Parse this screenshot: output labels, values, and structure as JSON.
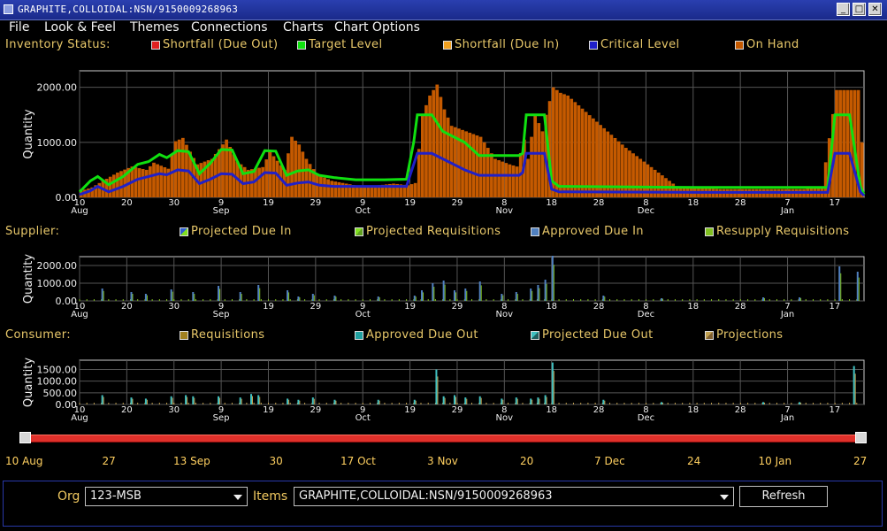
{
  "window": {
    "title": "GRAPHITE,COLLOIDAL:NSN/9150009268963"
  },
  "menu": [
    {
      "label": "File"
    },
    {
      "label": "Look & Feel"
    },
    {
      "label": "Themes"
    },
    {
      "label": "Connections"
    },
    {
      "label": "Charts"
    },
    {
      "label": "Chart Options"
    }
  ],
  "colors": {
    "on_hand": "#c55a00",
    "target": "#10e010",
    "critical": "#2020c8",
    "shortfall_out": "#e02020",
    "shortfall_in": "#f0a020",
    "slider": "#e0302a"
  },
  "inventory": {
    "title": "Inventory Status:",
    "legend": [
      {
        "label": "Shortfall (Due Out)",
        "color": "#e02020"
      },
      {
        "label": "Target Level",
        "color": "#10e010"
      },
      {
        "label": "Shortfall (Due In)",
        "color": "#f0a020"
      },
      {
        "label": "Critical Level",
        "color": "#2020c8"
      },
      {
        "label": "On Hand",
        "color": "#c55a00"
      }
    ]
  },
  "supplier": {
    "title": "Supplier:",
    "legend": [
      {
        "label": "Projected Due In",
        "color": "#3060d0"
      },
      {
        "label": "Projected Requisitions",
        "color": "#80e020"
      },
      {
        "label": "Approved Due In",
        "color": "#5080c0"
      },
      {
        "label": "Resupply Requisitions",
        "color": "#80c020"
      }
    ]
  },
  "consumer": {
    "title": "Consumer:",
    "legend": [
      {
        "label": "Requisitions",
        "color": "#a08020"
      },
      {
        "label": "Approved Due Out",
        "color": "#20a0a0"
      },
      {
        "label": "Projected Due Out",
        "color": "#40c0c0"
      },
      {
        "label": "Projections",
        "color": "#c0a050"
      }
    ]
  },
  "chart_data": [
    {
      "type": "area",
      "ylabel": "Quantity",
      "ylim": [
        0,
        2300
      ],
      "y_ticks": [
        "2000.00",
        "1000.00",
        "0.00"
      ],
      "x_ticks": [
        "10\nAug",
        "20",
        "30",
        "9\nSep",
        "19",
        "29",
        "9\nOct",
        "19",
        "29",
        "8\nNov",
        "18",
        "28",
        "8\nDec",
        "18",
        "28",
        "7\nJan",
        "17"
      ],
      "x_day_range": [
        0,
        170
      ],
      "on_hand": [
        [
          0,
          120
        ],
        [
          3,
          180
        ],
        [
          6,
          300
        ],
        [
          10,
          450
        ],
        [
          14,
          560
        ],
        [
          18,
          500
        ],
        [
          20,
          630
        ],
        [
          24,
          520
        ],
        [
          26,
          1020
        ],
        [
          28,
          1080
        ],
        [
          30,
          830
        ],
        [
          32,
          600
        ],
        [
          36,
          700
        ],
        [
          40,
          1050
        ],
        [
          43,
          650
        ],
        [
          46,
          500
        ],
        [
          50,
          550
        ],
        [
          52,
          830
        ],
        [
          56,
          500
        ],
        [
          58,
          1100
        ],
        [
          60,
          960
        ],
        [
          62,
          700
        ],
        [
          65,
          420
        ],
        [
          69,
          300
        ],
        [
          73,
          250
        ],
        [
          77,
          200
        ],
        [
          82,
          220
        ],
        [
          86,
          250
        ],
        [
          90,
          220
        ],
        [
          92,
          260
        ],
        [
          94,
          1500
        ],
        [
          96,
          1850
        ],
        [
          98,
          2050
        ],
        [
          100,
          1600
        ],
        [
          102,
          1300
        ],
        [
          104,
          1250
        ],
        [
          106,
          1200
        ],
        [
          110,
          1100
        ],
        [
          114,
          700
        ],
        [
          118,
          600
        ],
        [
          120,
          560
        ],
        [
          122,
          1050
        ],
        [
          123,
          700
        ],
        [
          125,
          1500
        ],
        [
          127,
          1200
        ],
        [
          128,
          1500
        ],
        [
          130,
          2000
        ],
        [
          132,
          1900
        ],
        [
          134,
          1850
        ],
        [
          150,
          900
        ],
        [
          164,
          200
        ],
        [
          176,
          150
        ],
        [
          188,
          150
        ],
        [
          199,
          150
        ],
        [
          204,
          200
        ],
        [
          208,
          1950
        ],
        [
          210,
          1950
        ],
        [
          214,
          1950
        ],
        [
          216,
          50
        ]
      ],
      "series": [
        {
          "name": "Target Level",
          "points": [
            [
              0,
              100
            ],
            [
              3,
              300
            ],
            [
              5,
              380
            ],
            [
              8,
              230
            ],
            [
              12,
              380
            ],
            [
              16,
              600
            ],
            [
              19,
              650
            ],
            [
              22,
              780
            ],
            [
              24,
              720
            ],
            [
              27,
              850
            ],
            [
              30,
              830
            ],
            [
              33,
              430
            ],
            [
              36,
              620
            ],
            [
              39,
              870
            ],
            [
              42,
              860
            ],
            [
              45,
              430
            ],
            [
              48,
              470
            ],
            [
              51,
              850
            ],
            [
              54,
              840
            ],
            [
              57,
              400
            ],
            [
              60,
              480
            ],
            [
              63,
              500
            ],
            [
              66,
              400
            ],
            [
              70,
              360
            ],
            [
              76,
              320
            ],
            [
              84,
              320
            ],
            [
              90,
              330
            ],
            [
              92,
              1000
            ],
            [
              93,
              1500
            ],
            [
              97,
              1500
            ],
            [
              100,
              1200
            ],
            [
              103,
              1100
            ],
            [
              106,
              1000
            ],
            [
              110,
              760
            ],
            [
              121,
              760
            ],
            [
              122,
              800
            ],
            [
              123,
              1500
            ],
            [
              127,
              1500
            ],
            [
              128,
              1500
            ],
            [
              130,
              300
            ],
            [
              132,
              200
            ],
            [
              170,
              180
            ],
            [
              206,
              180
            ],
            [
              208,
              1500
            ],
            [
              212,
              1500
            ],
            [
              215,
              200
            ],
            [
              216,
              50
            ]
          ]
        },
        {
          "name": "Critical Level",
          "points": [
            [
              0,
              50
            ],
            [
              3,
              120
            ],
            [
              5,
              200
            ],
            [
              8,
              100
            ],
            [
              12,
              200
            ],
            [
              16,
              330
            ],
            [
              19,
              380
            ],
            [
              22,
              430
            ],
            [
              24,
              410
            ],
            [
              27,
              500
            ],
            [
              30,
              480
            ],
            [
              33,
              250
            ],
            [
              36,
              330
            ],
            [
              39,
              430
            ],
            [
              42,
              420
            ],
            [
              45,
              250
            ],
            [
              48,
              280
            ],
            [
              51,
              450
            ],
            [
              54,
              440
            ],
            [
              57,
              220
            ],
            [
              60,
              260
            ],
            [
              63,
              280
            ],
            [
              66,
              220
            ],
            [
              70,
              200
            ],
            [
              84,
              200
            ],
            [
              90,
              200
            ],
            [
              92,
              600
            ],
            [
              93,
              800
            ],
            [
              97,
              800
            ],
            [
              100,
              700
            ],
            [
              103,
              600
            ],
            [
              106,
              500
            ],
            [
              110,
              400
            ],
            [
              121,
              400
            ],
            [
              122,
              450
            ],
            [
              123,
              800
            ],
            [
              127,
              800
            ],
            [
              128,
              800
            ],
            [
              130,
              150
            ],
            [
              132,
              100
            ],
            [
              170,
              90
            ],
            [
              206,
              90
            ],
            [
              208,
              800
            ],
            [
              212,
              800
            ],
            [
              215,
              100
            ],
            [
              216,
              30
            ]
          ]
        }
      ]
    },
    {
      "type": "bar",
      "ylabel": "Quantity",
      "ylim": [
        0,
        2500
      ],
      "y_ticks": [
        "2000.00",
        "1000.00",
        "0.00"
      ],
      "x_ticks": [
        "10\nAug",
        "20",
        "30",
        "9\nSep",
        "19",
        "29",
        "9\nOct",
        "19",
        "29",
        "8\nNov",
        "18",
        "28",
        "8\nDec",
        "18",
        "28",
        "7\nJan",
        "17"
      ],
      "x_day_range": [
        0,
        216
      ],
      "values": [
        [
          6,
          700
        ],
        [
          14,
          500
        ],
        [
          18,
          400
        ],
        [
          25,
          650
        ],
        [
          31,
          500
        ],
        [
          38,
          850
        ],
        [
          44,
          500
        ],
        [
          49,
          900
        ],
        [
          57,
          600
        ],
        [
          60,
          250
        ],
        [
          64,
          400
        ],
        [
          70,
          300
        ],
        [
          82,
          250
        ],
        [
          92,
          300
        ],
        [
          94,
          600
        ],
        [
          97,
          1000
        ],
        [
          100,
          1150
        ],
        [
          103,
          600
        ],
        [
          106,
          700
        ],
        [
          110,
          1100
        ],
        [
          116,
          400
        ],
        [
          120,
          500
        ],
        [
          124,
          700
        ],
        [
          126,
          900
        ],
        [
          128,
          1200
        ],
        [
          130,
          2550
        ],
        [
          144,
          300
        ],
        [
          160,
          150
        ],
        [
          188,
          200
        ],
        [
          198,
          200
        ],
        [
          209,
          1950
        ],
        [
          214,
          1650
        ]
      ]
    },
    {
      "type": "bar",
      "ylabel": "Quantity",
      "ylim": [
        0,
        1900
      ],
      "y_ticks": [
        "1500.00",
        "1000.00",
        "500.00",
        "0.00"
      ],
      "x_ticks": [
        "10\nAug",
        "20",
        "30",
        "9\nSep",
        "19",
        "29",
        "9\nOct",
        "19",
        "29",
        "8\nNov",
        "18",
        "28",
        "8\nDec",
        "18",
        "28",
        "7\nJan",
        "17"
      ],
      "x_day_range": [
        0,
        216
      ],
      "values": [
        [
          6,
          400
        ],
        [
          14,
          300
        ],
        [
          18,
          250
        ],
        [
          25,
          350
        ],
        [
          29,
          400
        ],
        [
          31,
          350
        ],
        [
          38,
          350
        ],
        [
          44,
          300
        ],
        [
          47,
          450
        ],
        [
          49,
          400
        ],
        [
          57,
          250
        ],
        [
          60,
          200
        ],
        [
          64,
          300
        ],
        [
          70,
          200
        ],
        [
          82,
          200
        ],
        [
          92,
          200
        ],
        [
          98,
          1500
        ],
        [
          100,
          350
        ],
        [
          103,
          400
        ],
        [
          106,
          300
        ],
        [
          110,
          350
        ],
        [
          116,
          250
        ],
        [
          120,
          300
        ],
        [
          124,
          250
        ],
        [
          126,
          300
        ],
        [
          128,
          400
        ],
        [
          130,
          1800
        ],
        [
          144,
          200
        ],
        [
          160,
          100
        ],
        [
          188,
          100
        ],
        [
          198,
          100
        ],
        [
          213,
          1650
        ]
      ]
    }
  ],
  "slider": {
    "labels": [
      "10 Aug",
      "27",
      "13 Sep",
      "30",
      "17 Oct",
      "3 Nov",
      "20",
      "7 Dec",
      "24",
      "10 Jan",
      "27"
    ]
  },
  "bottom": {
    "org_label": "Org",
    "org_value": "123-MSB",
    "items_label": "Items",
    "items_value": "GRAPHITE,COLLOIDAL:NSN/9150009268963",
    "refresh_label": "Refresh"
  }
}
